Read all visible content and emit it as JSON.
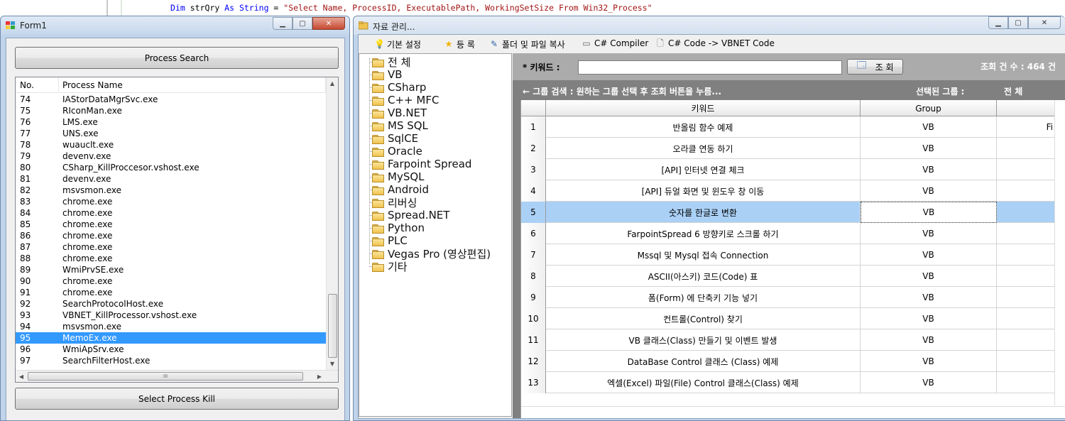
{
  "code": {
    "keyword_dim": "Dim",
    "variable": " strQry ",
    "keyword_as": "As",
    "type_name": " String",
    "equals": " = ",
    "string_literal": "\"Select Name, ProcessID, ExecutablePath, WorkingSetSize From Win32_Process\""
  },
  "form1": {
    "title": "Form1",
    "search_button": "Process Search",
    "kill_button": "Select Process Kill",
    "columns": [
      "No.",
      "Process Name"
    ],
    "rows": [
      {
        "no": "74",
        "name": "IAStorDataMgrSvc.exe"
      },
      {
        "no": "75",
        "name": "RIconMan.exe"
      },
      {
        "no": "76",
        "name": "LMS.exe"
      },
      {
        "no": "77",
        "name": "UNS.exe"
      },
      {
        "no": "78",
        "name": "wuauclt.exe"
      },
      {
        "no": "79",
        "name": "devenv.exe"
      },
      {
        "no": "80",
        "name": "CSharp_KillProccesor.vshost.exe"
      },
      {
        "no": "81",
        "name": "devenv.exe"
      },
      {
        "no": "82",
        "name": "msvsmon.exe"
      },
      {
        "no": "83",
        "name": "chrome.exe"
      },
      {
        "no": "84",
        "name": "chrome.exe"
      },
      {
        "no": "85",
        "name": "chrome.exe"
      },
      {
        "no": "86",
        "name": "chrome.exe"
      },
      {
        "no": "87",
        "name": "chrome.exe"
      },
      {
        "no": "88",
        "name": "chrome.exe"
      },
      {
        "no": "89",
        "name": "WmiPrvSE.exe"
      },
      {
        "no": "90",
        "name": "chrome.exe"
      },
      {
        "no": "91",
        "name": "chrome.exe"
      },
      {
        "no": "92",
        "name": "SearchProtocolHost.exe"
      },
      {
        "no": "93",
        "name": "VBNET_KillProcessor.vshost.exe"
      },
      {
        "no": "94",
        "name": "msvsmon.exe"
      },
      {
        "no": "95",
        "name": "MemoEx.exe"
      },
      {
        "no": "96",
        "name": "WmiApSrv.exe"
      },
      {
        "no": "97",
        "name": "SearchFilterHost.exe"
      }
    ],
    "selected_no": "95",
    "hscroll_grip": "III"
  },
  "datawin": {
    "title": "자료 관리...",
    "menu": [
      {
        "label": "기본 설정",
        "icon": "bulb-icon"
      },
      {
        "label": "등 록",
        "icon": "star-icon"
      },
      {
        "label": "폴더 및 파일 복사",
        "icon": "pen-icon"
      },
      {
        "label": "C# Compiler",
        "icon": "window-icon"
      },
      {
        "label": "C# Code -> VBNET Code",
        "icon": "document-icon"
      }
    ],
    "tree": [
      "전 체",
      "VB",
      "CSharp",
      "C++ MFC",
      "VB.NET",
      "MS SQL",
      "SqlCE",
      "Oracle",
      "Farpoint Spread",
      "MySQL",
      "Android",
      "리버싱",
      "Spread.NET",
      "Python",
      "PLC",
      "Vegas Pro (영상편집)",
      "기타"
    ],
    "search": {
      "label": "* 키워드 :",
      "value": "",
      "button": "조 회",
      "count": "조회 건 수 : 464 건"
    },
    "hint": "← 그룹 검색 : 원하는 그룹 선택 후 조회 버튼을 누름...",
    "selected_group_label": "선택된 그룹 :",
    "selected_group_value": "전 체",
    "grid": {
      "columns": [
        "키워드",
        "Group"
      ],
      "extra_fragment": "Fi",
      "rows": [
        {
          "n": "1",
          "keyword": "반올림 함수 예제",
          "group": "VB"
        },
        {
          "n": "2",
          "keyword": "오라클 연동 하기",
          "group": "VB"
        },
        {
          "n": "3",
          "keyword": "[API] 인터넷 연결 체크",
          "group": "VB"
        },
        {
          "n": "4",
          "keyword": "[API] 듀얼 화면 및 윈도우 창 이동",
          "group": "VB"
        },
        {
          "n": "5",
          "keyword": "숫자를 한글로 변환",
          "group": "VB"
        },
        {
          "n": "6",
          "keyword": "FarpointSpread  6 방향키로 스크롤 하기",
          "group": "VB"
        },
        {
          "n": "7",
          "keyword": "Mssql 및 Mysql 접속 Connection",
          "group": "VB"
        },
        {
          "n": "8",
          "keyword": "ASCII(아스키) 코드(Code) 표",
          "group": "VB"
        },
        {
          "n": "9",
          "keyword": "폼(Form) 에 단축키 기능 넣기",
          "group": "VB"
        },
        {
          "n": "10",
          "keyword": "컨트롤(Control) 찾기",
          "group": "VB"
        },
        {
          "n": "11",
          "keyword": "VB 클래스(Class) 만들기 및 이벤트 발생",
          "group": "VB"
        },
        {
          "n": "12",
          "keyword": "DataBase  Control 클래스 (Class) 예제",
          "group": "VB"
        },
        {
          "n": "13",
          "keyword": "엑셀(Excel) 파일(File) Control 클래스(Class) 예제",
          "group": "VB"
        }
      ],
      "selected_row": "5"
    }
  },
  "colors": {
    "selection_blue": "#3399ff",
    "grid_selection": "#aad0f5",
    "header_gray": "#ababab",
    "pane_gray": "#808080",
    "close_red": "#c54a32"
  }
}
